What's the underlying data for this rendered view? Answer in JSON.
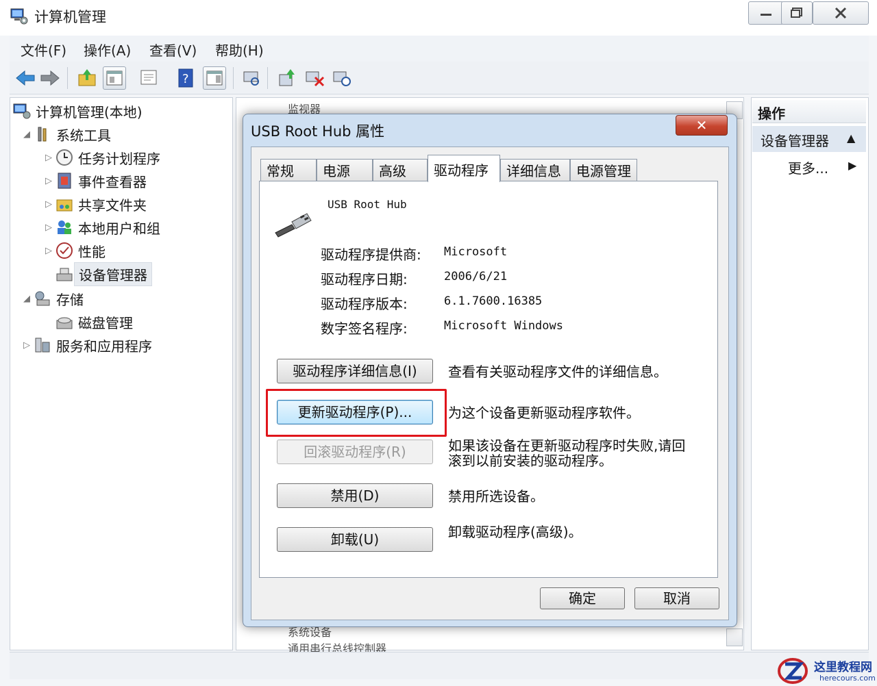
{
  "window": {
    "title": "计算机管理",
    "icon": "computer-management-icon"
  },
  "menu": {
    "file": "文件(F)",
    "action": "操作(A)",
    "view": "查看(V)",
    "help": "帮助(H)"
  },
  "toolbar": {
    "icons": [
      "back-arrow-icon",
      "forward-arrow-icon",
      "up-folder-icon",
      "show-hide-tree-icon",
      "properties-icon",
      "help-icon",
      "show-hide-action-pane-icon",
      "scan-hardware-icon",
      "update-driver-icon",
      "disable-device-icon",
      "uninstall-device-icon"
    ]
  },
  "tree": {
    "root": "计算机管理(本地)",
    "system_tools": "系统工具",
    "task_scheduler": "任务计划程序",
    "event_viewer": "事件查看器",
    "shared_folders": "共享文件夹",
    "local_users": "本地用户和组",
    "performance": "性能",
    "device_manager": "设备管理器",
    "storage": "存储",
    "disk_management": "磁盘管理",
    "services_apps": "服务和应用程序"
  },
  "middle": {
    "ghost_top": "监视器",
    "ghost_bottom1": "系统设备",
    "ghost_bottom2": "通用串行总线控制器"
  },
  "actions": {
    "header": "操作",
    "group": "设备管理器",
    "more": "更多..."
  },
  "dialog": {
    "title": "USB Root Hub 属性",
    "close": "✕",
    "tabs": [
      "常规",
      "电源",
      "高级",
      "驱动程序",
      "详细信息",
      "电源管理"
    ],
    "active_tab": "驱动程序",
    "device_name": "USB Root Hub",
    "props": [
      {
        "label": "驱动程序提供商:",
        "value": "Microsoft"
      },
      {
        "label": "驱动程序日期:",
        "value": "2006/6/21"
      },
      {
        "label": "驱动程序版本:",
        "value": "6.1.7600.16385"
      },
      {
        "label": "数字签名程序:",
        "value": "Microsoft Windows"
      }
    ],
    "buttons": [
      {
        "label": "驱动程序详细信息(I)",
        "desc": "查看有关驱动程序文件的详细信息。"
      },
      {
        "label": "更新驱动程序(P)...",
        "desc": "为这个设备更新驱动程序软件。"
      },
      {
        "label": "回滚驱动程序(R)",
        "desc": "如果该设备在更新驱动程序时失败,请回滚到以前安装的驱动程序。"
      },
      {
        "label": "禁用(D)",
        "desc": "禁用所选设备。"
      },
      {
        "label": "卸载(U)",
        "desc": "卸载驱动程序(高级)。"
      }
    ],
    "ok": "确定",
    "cancel": "取消"
  },
  "watermark": {
    "name": "这里教程网",
    "url": "herecours.com"
  },
  "colors": {
    "highlight": "#e0151b",
    "close_button": "#c7452f",
    "watermark": "#1b3f9e"
  }
}
